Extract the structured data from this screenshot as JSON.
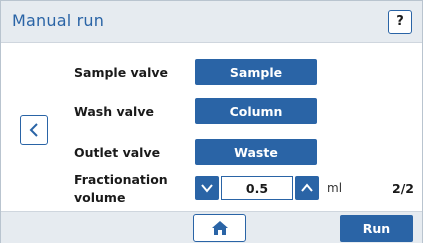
{
  "header": {
    "title": "Manual run",
    "help_label": "?"
  },
  "rows": {
    "sample_valve": {
      "label": "Sample valve",
      "value": "Sample"
    },
    "wash_valve": {
      "label": "Wash valve",
      "value": "Column"
    },
    "outlet_valve": {
      "label": "Outlet valve",
      "value": "Waste"
    },
    "fractionation": {
      "label_line1": "Fractionation",
      "label_line2": "volume",
      "value": "0.5",
      "unit": "ml"
    }
  },
  "page_indicator": "2/2",
  "footer": {
    "run_label": "Run"
  },
  "icons": {
    "back": "chevron-left-icon",
    "help": "question-icon",
    "home": "home-icon",
    "decrease": "chevron-down-icon",
    "increase": "chevron-up-icon"
  },
  "colors": {
    "accent": "#2a64a6",
    "header_bg": "#e6ebf0",
    "title_text": "#2a64a6"
  }
}
